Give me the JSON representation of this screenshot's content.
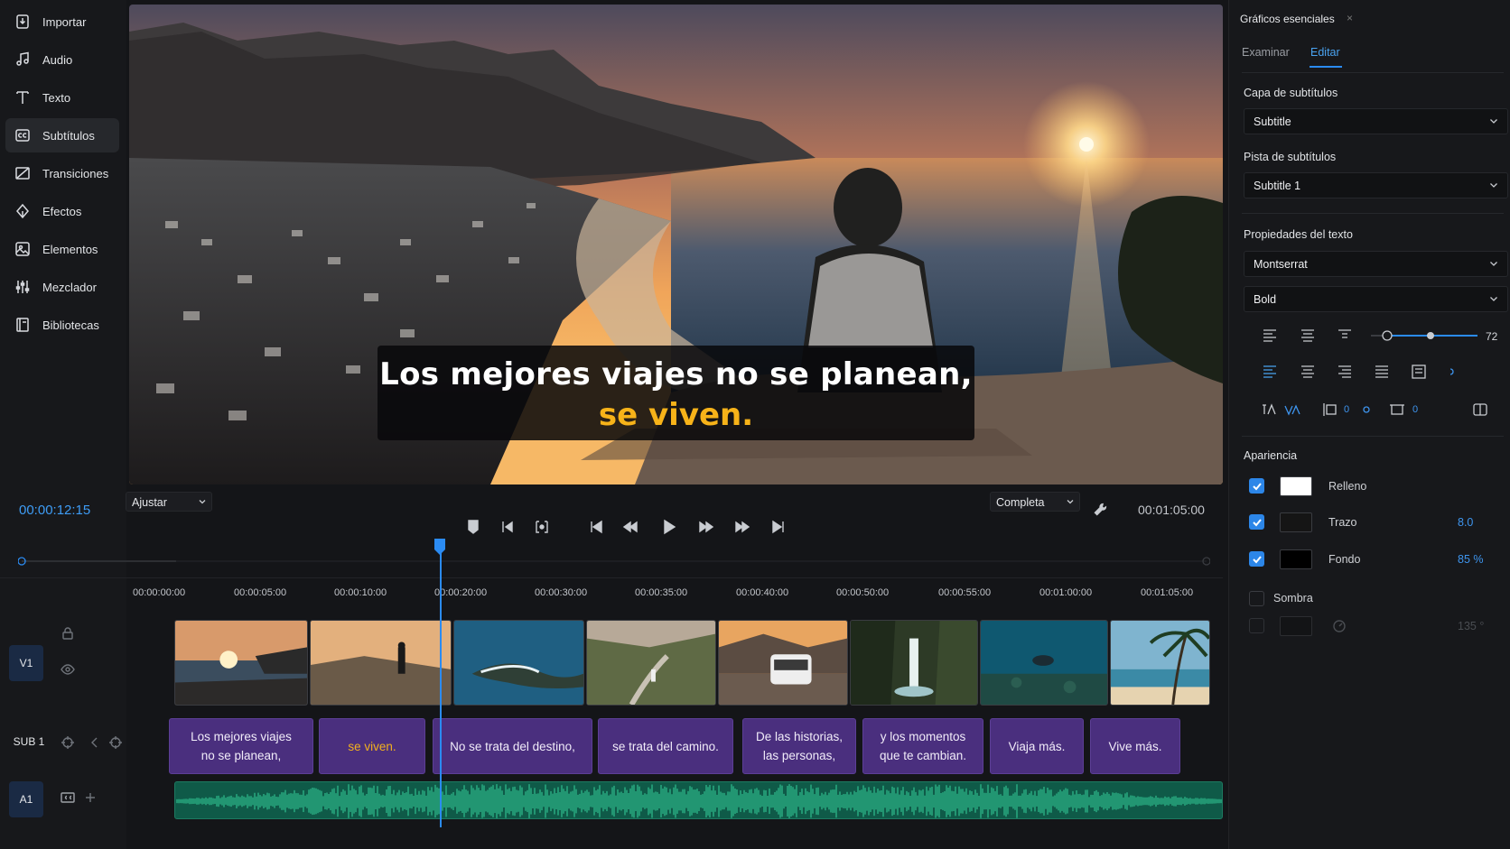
{
  "sidebar": {
    "items": [
      {
        "label": "Importar",
        "icon": "import-icon"
      },
      {
        "label": "Audio",
        "icon": "music-note-icon"
      },
      {
        "label": "Texto",
        "icon": "text-icon"
      },
      {
        "label": "Subtítulos",
        "icon": "captions-icon",
        "active": true
      },
      {
        "label": "Transiciones",
        "icon": "transition-icon"
      },
      {
        "label": "Efectos",
        "icon": "effects-icon"
      },
      {
        "label": "Elementos",
        "icon": "elements-icon"
      },
      {
        "label": "Mezclador",
        "icon": "mixer-icon"
      },
      {
        "label": "Bibliotecas",
        "icon": "library-icon"
      }
    ]
  },
  "preview": {
    "subtitle_line1": "Los mejores viajes no se planean,",
    "subtitle_line2": "se viven.",
    "subtitle_highlight_color": "#f7b319"
  },
  "transport": {
    "current_time": "00:00:12:15",
    "fit_label": "Ajustar",
    "quality_label": "Completa",
    "duration": "00:01:05:00"
  },
  "timeline": {
    "ruler": [
      "00:00:00:00",
      "00:00:05:00",
      "00:00:10:00",
      "00:00:20:00",
      "00:00:30:00",
      "00:00:35:00",
      "00:00:40:00",
      "00:00:50:00",
      "00:00:55:00",
      "00:01:00:00",
      "00:01:05:00"
    ],
    "tracks": {
      "video": "V1",
      "subtitles": "SUB 1",
      "audio": "A1"
    },
    "subtitle_clips": [
      {
        "line1": "Los mejores viajes",
        "line2": "no se planean,"
      },
      {
        "line1": "se viven.",
        "line2": ""
      },
      {
        "line1": "No se trata del destino,",
        "line2": ""
      },
      {
        "line1": "se trata del camino.",
        "line2": ""
      },
      {
        "line1": "De las historias,",
        "line2": "las personas,"
      },
      {
        "line1": "y los momentos",
        "line2": "que te cambian."
      },
      {
        "line1": "Viaja más.",
        "line2": ""
      },
      {
        "line1": "Vive más.",
        "line2": ""
      }
    ],
    "thumbnails": [
      "sunset-coast",
      "hiker-cliff",
      "ocean-rocks",
      "mountain-road",
      "camper-van",
      "waterfall",
      "underwater",
      "palm-beach"
    ]
  },
  "panel": {
    "title": "Gráficos esenciales",
    "close": "×",
    "tabs": [
      "Examinar",
      "Editar"
    ],
    "active_tab": "Editar",
    "subtitle_layer_label": "Capa de subtítulos",
    "subtitle_layer_value": "Subtitle",
    "subtitle_track_label": "Pista de subtítulos",
    "subtitle_track_value": "Subtitle 1",
    "text_props_label": "Propiedades del texto",
    "font_family": "Montserrat",
    "font_style": "Bold",
    "font_size": "72",
    "tracking_value": "0",
    "kerning_value": "0",
    "rotation_value": "0",
    "appearance_label": "Apariencia",
    "fill": {
      "label": "Relleno",
      "color": "#ffffff",
      "checked": true
    },
    "stroke": {
      "label": "Trazo",
      "color": "#151515",
      "value": "8.0",
      "checked": true
    },
    "background": {
      "label": "Fondo",
      "color": "#000000",
      "value": "85 %",
      "checked": true
    },
    "shadow": {
      "label": "Sombra",
      "value": "135 °",
      "checked": false
    }
  }
}
